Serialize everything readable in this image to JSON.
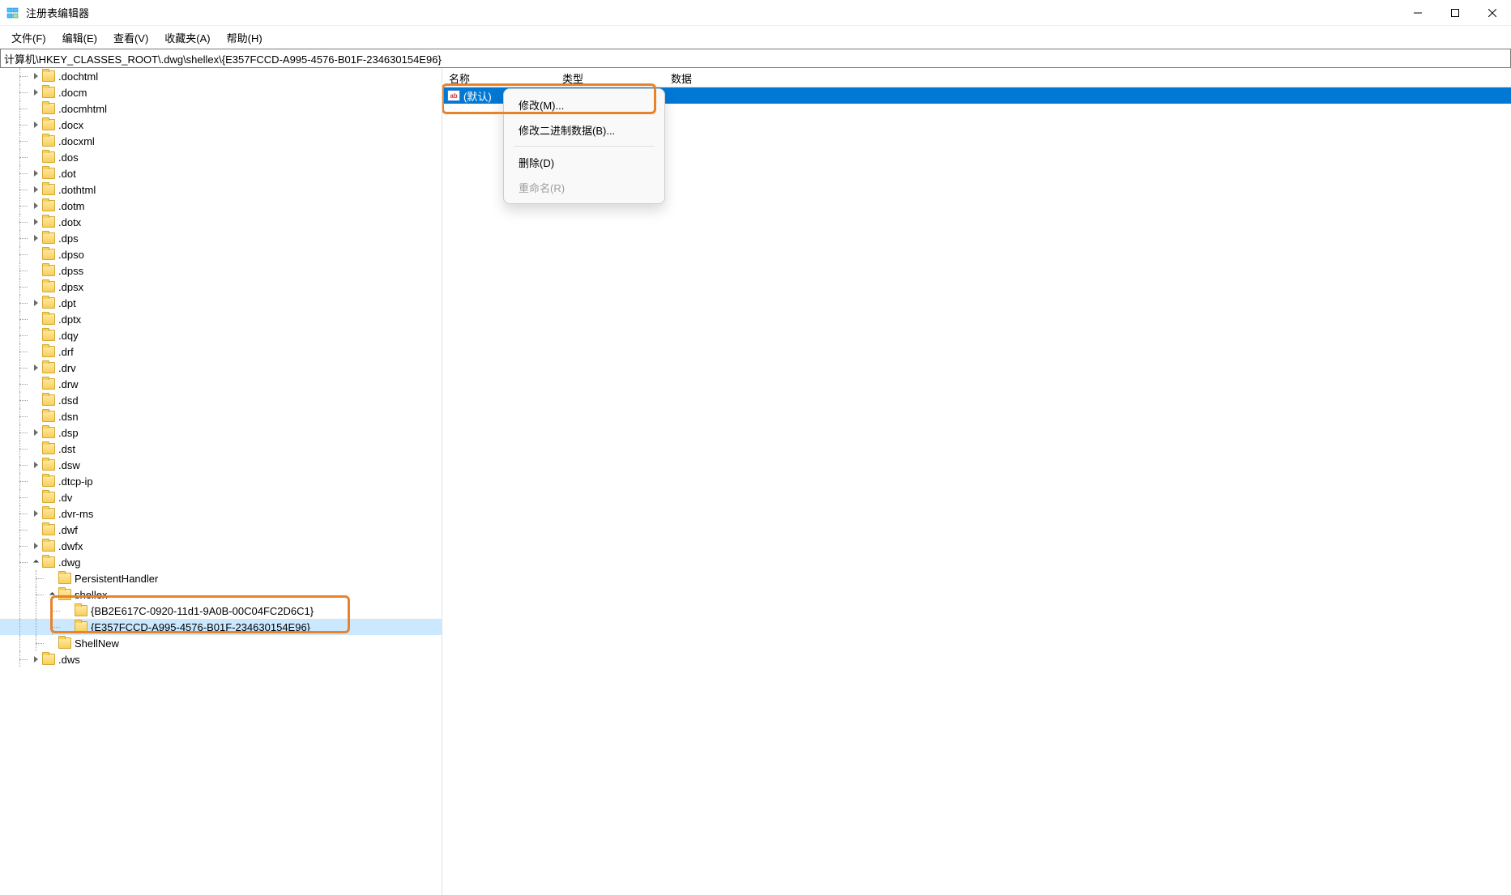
{
  "window": {
    "title": "注册表编辑器"
  },
  "menu": {
    "file": "文件(F)",
    "edit": "编辑(E)",
    "view": "查看(V)",
    "favorites": "收藏夹(A)",
    "help": "帮助(H)"
  },
  "addressbar": {
    "path": "计算机\\HKEY_CLASSES_ROOT\\.dwg\\shellex\\{E357FCCD-A995-4576-B01F-234630154E96}"
  },
  "tree": {
    "items": [
      {
        "label": ".dochtml",
        "indent": 2,
        "expand": "collapsed"
      },
      {
        "label": ".docm",
        "indent": 2,
        "expand": "collapsed"
      },
      {
        "label": ".docmhtml",
        "indent": 2,
        "expand": "empty"
      },
      {
        "label": ".docx",
        "indent": 2,
        "expand": "collapsed"
      },
      {
        "label": ".docxml",
        "indent": 2,
        "expand": "empty"
      },
      {
        "label": ".dos",
        "indent": 2,
        "expand": "empty"
      },
      {
        "label": ".dot",
        "indent": 2,
        "expand": "collapsed"
      },
      {
        "label": ".dothtml",
        "indent": 2,
        "expand": "collapsed"
      },
      {
        "label": ".dotm",
        "indent": 2,
        "expand": "collapsed"
      },
      {
        "label": ".dotx",
        "indent": 2,
        "expand": "collapsed"
      },
      {
        "label": ".dps",
        "indent": 2,
        "expand": "collapsed"
      },
      {
        "label": ".dpso",
        "indent": 2,
        "expand": "empty"
      },
      {
        "label": ".dpss",
        "indent": 2,
        "expand": "empty"
      },
      {
        "label": ".dpsx",
        "indent": 2,
        "expand": "empty"
      },
      {
        "label": ".dpt",
        "indent": 2,
        "expand": "collapsed"
      },
      {
        "label": ".dptx",
        "indent": 2,
        "expand": "empty"
      },
      {
        "label": ".dqy",
        "indent": 2,
        "expand": "empty"
      },
      {
        "label": ".drf",
        "indent": 2,
        "expand": "empty"
      },
      {
        "label": ".drv",
        "indent": 2,
        "expand": "collapsed"
      },
      {
        "label": ".drw",
        "indent": 2,
        "expand": "empty"
      },
      {
        "label": ".dsd",
        "indent": 2,
        "expand": "empty"
      },
      {
        "label": ".dsn",
        "indent": 2,
        "expand": "empty"
      },
      {
        "label": ".dsp",
        "indent": 2,
        "expand": "collapsed"
      },
      {
        "label": ".dst",
        "indent": 2,
        "expand": "empty"
      },
      {
        "label": ".dsw",
        "indent": 2,
        "expand": "collapsed"
      },
      {
        "label": ".dtcp-ip",
        "indent": 2,
        "expand": "empty"
      },
      {
        "label": ".dv",
        "indent": 2,
        "expand": "empty"
      },
      {
        "label": ".dvr-ms",
        "indent": 2,
        "expand": "collapsed"
      },
      {
        "label": ".dwf",
        "indent": 2,
        "expand": "empty"
      },
      {
        "label": ".dwfx",
        "indent": 2,
        "expand": "collapsed"
      },
      {
        "label": ".dwg",
        "indent": 2,
        "expand": "expanded"
      },
      {
        "label": "PersistentHandler",
        "indent": 3,
        "expand": "empty"
      },
      {
        "label": "shellex",
        "indent": 3,
        "expand": "expanded"
      },
      {
        "label": "{BB2E617C-0920-11d1-9A0B-00C04FC2D6C1}",
        "indent": 4,
        "expand": "empty"
      },
      {
        "label": "{E357FCCD-A995-4576-B01F-234630154E96}",
        "indent": 4,
        "expand": "empty",
        "selected": true
      },
      {
        "label": "ShellNew",
        "indent": 3,
        "expand": "empty"
      },
      {
        "label": ".dws",
        "indent": 2,
        "expand": "collapsed"
      }
    ]
  },
  "list": {
    "columns": {
      "name": "名称",
      "type": "类型",
      "data": "数据"
    },
    "rows": [
      {
        "name": "(默认)",
        "type": "",
        "data": "",
        "selected": true
      }
    ]
  },
  "context_menu": {
    "modify": "修改(M)...",
    "modify_binary": "修改二进制数据(B)...",
    "delete": "删除(D)",
    "rename": "重命名(R)"
  }
}
